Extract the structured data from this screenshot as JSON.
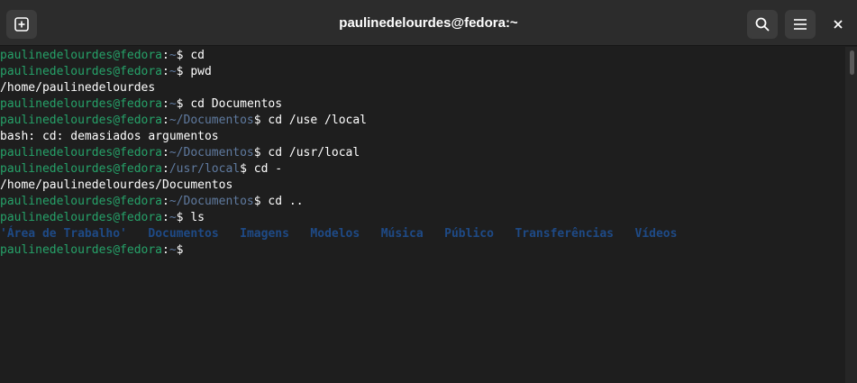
{
  "window": {
    "title": "paulinedelourdes@fedora:~"
  },
  "toolbar": {
    "new_tab_icon": "plus-square-icon",
    "search_icon": "search-icon",
    "menu_icon": "hamburger-menu-icon",
    "close_icon": "close-icon"
  },
  "prompt": {
    "user": "paulinedelourdes@fedora",
    "sep": ":",
    "dollar": "$ "
  },
  "terminal": {
    "lines": [
      {
        "type": "prompt",
        "path": "~",
        "cmd": "cd"
      },
      {
        "type": "prompt",
        "path": "~",
        "cmd": "pwd"
      },
      {
        "type": "output",
        "text": "/home/paulinedelourdes"
      },
      {
        "type": "prompt",
        "path": "~",
        "cmd": "cd Documentos"
      },
      {
        "type": "prompt",
        "path": "~/Documentos",
        "cmd": "cd /use /local"
      },
      {
        "type": "output",
        "text": "bash: cd: demasiados argumentos"
      },
      {
        "type": "prompt",
        "path": "~/Documentos",
        "cmd": "cd /usr/local"
      },
      {
        "type": "prompt",
        "path": "/usr/local",
        "cmd": "cd -"
      },
      {
        "type": "output",
        "text": "/home/paulinedelourdes/Documentos"
      },
      {
        "type": "prompt",
        "path": "~/Documentos",
        "cmd": "cd .."
      },
      {
        "type": "prompt",
        "path": "~",
        "cmd": "ls"
      },
      {
        "type": "ls",
        "items": [
          "'Área de Trabalho'",
          "Documentos",
          "Imagens",
          "Modelos",
          "Música",
          "Público",
          "Transferências",
          "Vídeos"
        ]
      },
      {
        "type": "prompt",
        "path": "~",
        "cmd": ""
      }
    ]
  },
  "colors": {
    "background": "#1e1e1e",
    "titlebar": "#2c2c2c",
    "user": "#26a269",
    "path": "#5f7a9f",
    "directory": "#1e4a86",
    "text": "#ffffff"
  }
}
